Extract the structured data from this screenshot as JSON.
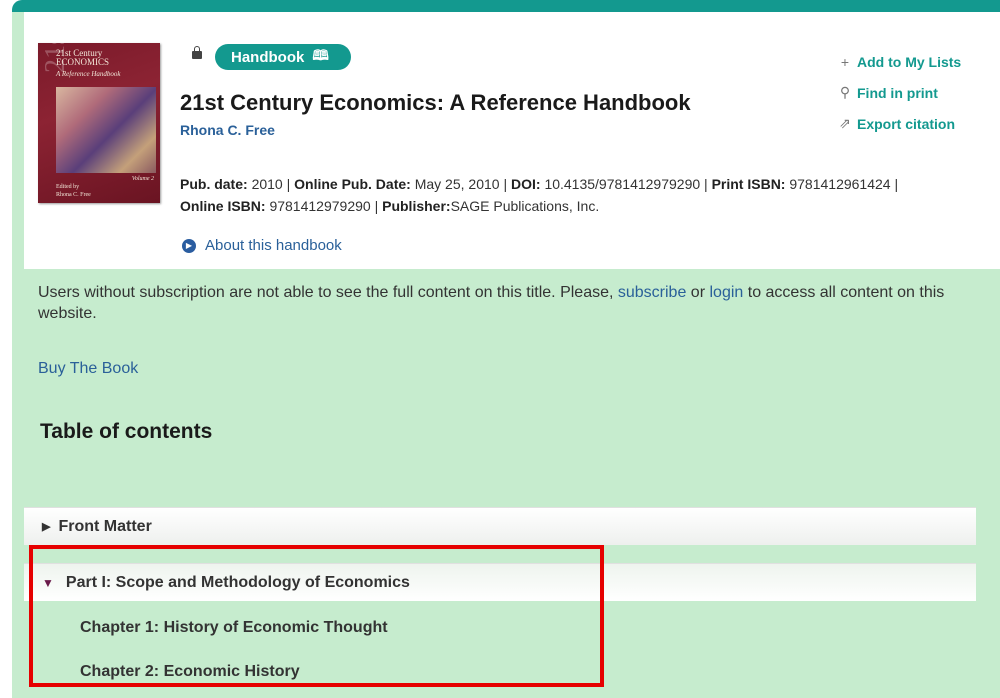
{
  "book": {
    "badge_label": "Handbook",
    "title": "21st Century Economics: A Reference Handbook",
    "author": "Rhona C. Free",
    "meta": {
      "pub_date_label": "Pub. date:",
      "pub_date": "2010",
      "online_pub_label": "Online Pub. Date:",
      "online_pub_date": "May 25, 2010",
      "doi_label": "DOI:",
      "doi": "10.4135/9781412979290",
      "print_isbn_label": "Print ISBN:",
      "print_isbn": "9781412961424",
      "online_isbn_label": "Online ISBN:",
      "online_isbn": "9781412979290",
      "publisher_label": "Publisher:",
      "publisher": "SAGE Publications, Inc."
    },
    "about_link": "About this handbook",
    "cover": {
      "title_line1": "21st Century",
      "title_line2": "ECONOMICS",
      "subtitle": "A Reference Handbook",
      "volume": "Volume 2",
      "edited_by": "Edited by",
      "editor": "Rhona C. Free"
    }
  },
  "actions": {
    "add_to_lists": "Add to My Lists",
    "find_in_print": "Find in print",
    "export_citation": "Export citation"
  },
  "notice": {
    "text_before": "Users without subscription are not able to see the full content on this title. Please, ",
    "subscribe": "subscribe",
    "or": " or ",
    "login": "login",
    "text_after": " to access all content on this website."
  },
  "buy_link": "Buy The Book",
  "toc": {
    "heading": "Table of contents",
    "front_matter": "Front Matter",
    "part1": "Part I: Scope and Methodology of Economics",
    "chapters": [
      "Chapter 1: History of Economic Thought",
      "Chapter 2: Economic History"
    ]
  },
  "colors": {
    "teal": "#13998f",
    "green_bg": "#c6ecce",
    "link_blue": "#2a6099",
    "highlight_red": "#e60000"
  }
}
